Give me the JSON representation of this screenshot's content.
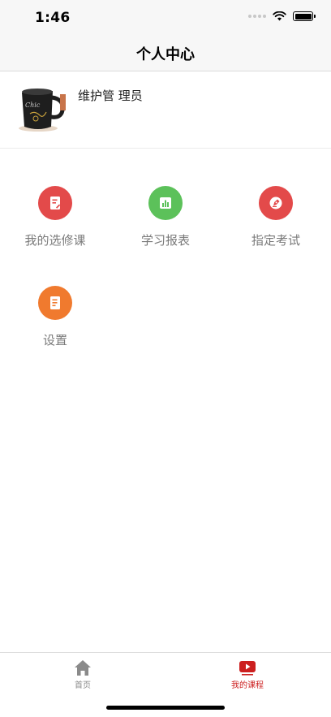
{
  "status_bar": {
    "time": "1:46",
    "icons": [
      "signal-icon",
      "wifi-icon",
      "battery-icon"
    ]
  },
  "nav": {
    "title": "个人中心"
  },
  "profile": {
    "name": "维护管 理员",
    "avatar_text": "Chic"
  },
  "menu": {
    "items": [
      {
        "label": "我的选修课",
        "icon": "edit-note-icon",
        "color": "#e34a4a"
      },
      {
        "label": "学习报表",
        "icon": "bar-chart-icon",
        "color": "#5cc15a"
      },
      {
        "label": "指定考试",
        "icon": "pen-nib-icon",
        "color": "#e34a4a"
      },
      {
        "label": "设置",
        "icon": "document-icon",
        "color": "#f07a2e"
      }
    ]
  },
  "tabbar": {
    "tabs": [
      {
        "label": "首页",
        "icon": "home-icon",
        "color": "#8a8a8a",
        "active": false
      },
      {
        "label": "我的课程",
        "icon": "play-video-icon",
        "color": "#cc1f1f",
        "active": true
      }
    ]
  }
}
